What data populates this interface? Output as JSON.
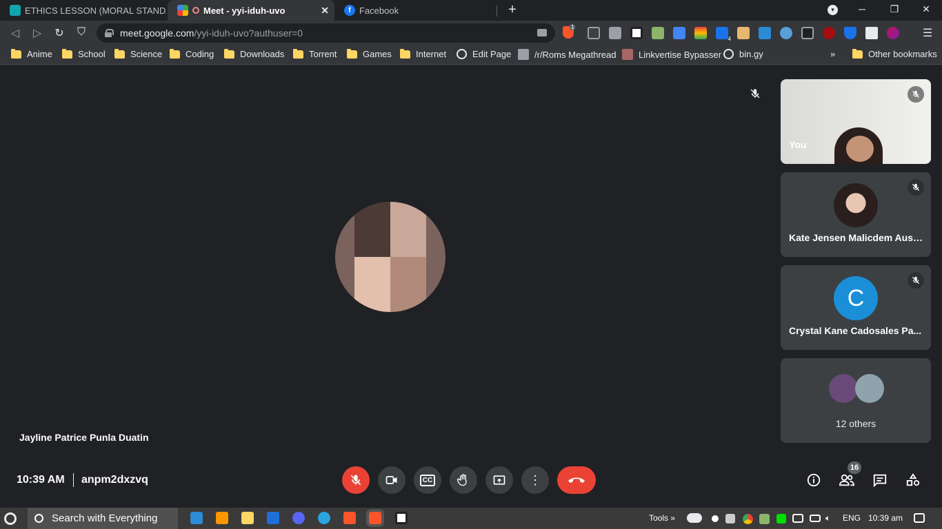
{
  "browser": {
    "tabs": [
      {
        "title": "ETHICS LESSON (MORAL STANDARD/M",
        "active": false
      },
      {
        "title": "Meet - yyi-iduh-uvo",
        "active": true
      },
      {
        "title": "Facebook",
        "active": false
      }
    ],
    "new_tab_label": "+",
    "url_host": "meet.google.com",
    "url_path": "/yyi-iduh-uvo?authuser=0",
    "brave_badge": "1",
    "ext_badge": "4",
    "bookmarks": [
      {
        "label": "Anime",
        "icon": "folder-icon"
      },
      {
        "label": "School",
        "icon": "folder-icon"
      },
      {
        "label": "Science",
        "icon": "folder-icon"
      },
      {
        "label": "Coding",
        "icon": "folder-icon"
      },
      {
        "label": "Downloads",
        "icon": "folder-icon"
      },
      {
        "label": "Torrent",
        "icon": "folder-icon"
      },
      {
        "label": "Games",
        "icon": "folder-icon"
      },
      {
        "label": "Internet",
        "icon": "folder-icon"
      },
      {
        "label": "Edit Page",
        "icon": "globe-icon"
      },
      {
        "label": "/r/Roms Megathread",
        "icon": "reddit-icon"
      },
      {
        "label": "Linkvertise Bypasser",
        "icon": "site-icon"
      },
      {
        "label": "bin.gy",
        "icon": "globe-icon"
      }
    ],
    "bookmarks_overflow": "»",
    "other_bookmarks": "Other bookmarks"
  },
  "meet": {
    "main_speaker_name": "Jayline Patrice Punla Duatin",
    "participants": [
      {
        "name": "You",
        "muted": true,
        "type": "video"
      },
      {
        "name": "Kate Jensen Malicdem Aust...",
        "muted": true,
        "type": "photo"
      },
      {
        "name": "Crystal Kane Cadosales Pa...",
        "muted": true,
        "type": "letter",
        "letter": "C",
        "color": "#1a8fd8"
      },
      {
        "name": "12 others",
        "type": "group"
      }
    ],
    "time": "10:39 AM",
    "meeting_code": "anpm2dxzvq",
    "participant_count": "16",
    "controls": [
      "mic-off-icon",
      "camera-icon",
      "captions-icon",
      "raise-hand-icon",
      "present-icon",
      "more-icon",
      "end-call-icon"
    ],
    "captions_label": "CC"
  },
  "taskbar": {
    "search_text": "Search with Everything",
    "tools_label": "Tools",
    "tools_chevron": "»",
    "language": "ENG",
    "clock": "10:39 am"
  }
}
